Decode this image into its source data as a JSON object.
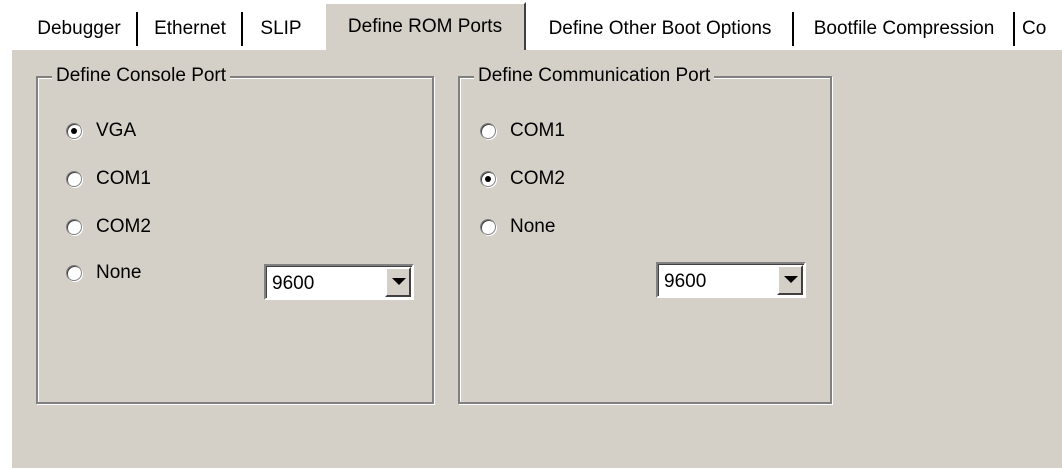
{
  "tabs": [
    {
      "label": "Debugger"
    },
    {
      "label": "Ethernet"
    },
    {
      "label": "SLIP"
    },
    {
      "label": "Define ROM Ports",
      "active": true
    },
    {
      "label": "Define Other Boot Options"
    },
    {
      "label": "Bootfile Compression"
    },
    {
      "label": "Co"
    }
  ],
  "console_group": {
    "title": "Define Console Port",
    "options": [
      {
        "label": "VGA",
        "selected": true
      },
      {
        "label": "COM1",
        "selected": false
      },
      {
        "label": "COM2",
        "selected": false
      },
      {
        "label": "None",
        "selected": false
      }
    ],
    "baud": "9600"
  },
  "comm_group": {
    "title": "Define Communication Port",
    "options": [
      {
        "label": "COM1",
        "selected": false
      },
      {
        "label": "COM2",
        "selected": true
      },
      {
        "label": "None",
        "selected": false
      }
    ],
    "baud": "9600"
  },
  "colors": {
    "face": "#d4d0c8",
    "shadow": "#808080",
    "highlight": "#ffffff"
  }
}
